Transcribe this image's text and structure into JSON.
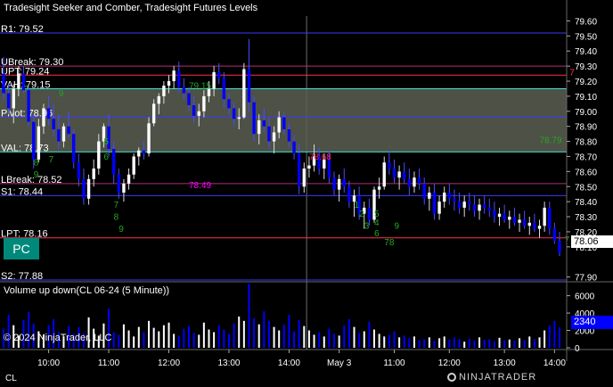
{
  "chart_data": {
    "type": "candlestick",
    "title": "Tradesight Seeker and Comber, Tradesight Futures Levels",
    "price_axis": {
      "min": 77.88,
      "max": 79.65,
      "ticks": [
        "79.60",
        "79.50",
        "79.40",
        "79.30",
        "79.20",
        "79.10",
        "79.00",
        "78.90",
        "78.80",
        "78.70",
        "78.60",
        "78.50",
        "78.40",
        "78.30",
        "78.20",
        "78.10",
        "77.90"
      ]
    },
    "time_axis": {
      "labels": [
        "10:00",
        "11:00",
        "12:00",
        "13:00",
        "14:00",
        "May 3",
        "11:00",
        "12:00",
        "13:00",
        "14:00"
      ]
    },
    "session_break_label": "May 3",
    "levels": [
      {
        "label": "R1: 79.52",
        "value": 79.52,
        "color": "#3a3aff"
      },
      {
        "label": "UBreak: 79.30",
        "value": 79.3,
        "color": "#b03070"
      },
      {
        "label": "UPT: 79.24",
        "value": 79.24,
        "color": "#ff3050"
      },
      {
        "label": "VAH: 79.15",
        "value": 79.15,
        "color": "#40e0d0"
      },
      {
        "label": "Pivot: 78.96",
        "value": 78.96,
        "color": "#3a3aff"
      },
      {
        "label": "VAL: 78.73",
        "value": 78.73,
        "color": "#40e0d0"
      },
      {
        "label": "LBreak: 78.52",
        "value": 78.52,
        "color": "#b03070"
      },
      {
        "label": "S1: 78.44",
        "value": 78.44,
        "color": "#3a3aff"
      },
      {
        "label": "LPT: 78.16",
        "value": 78.16,
        "color": "#ff3050"
      },
      {
        "label": "S2: 77.88",
        "value": 77.88,
        "color": "#3a3aff"
      }
    ],
    "value_area": {
      "top": 79.15,
      "bottom": 78.73,
      "color": "#5a5f52"
    },
    "annotations": [
      {
        "text": "78.49",
        "price": 78.49,
        "bar": 37,
        "color": "#ff00ff"
      },
      {
        "text": "78.68",
        "price": 78.68,
        "bar": 61,
        "color": "#ff2060"
      },
      {
        "text": "79.15",
        "price": 79.15,
        "bar": 37,
        "color": "#22aa22"
      },
      {
        "text": "78.79",
        "price": 78.79,
        "bar": 107,
        "color": "#22aa22"
      },
      {
        "text": "7",
        "price": 79.24,
        "bar": 113,
        "color": "#ff3050"
      },
      {
        "text": "7",
        "price": 79.13,
        "bar": 4,
        "color": "#22aa22"
      },
      {
        "text": "8",
        "price": 78.64,
        "bar": 6,
        "color": "#22aa22"
      },
      {
        "text": "9",
        "price": 78.56,
        "bar": 6,
        "color": "#22aa22"
      },
      {
        "text": "9",
        "price": 79.1,
        "bar": 11,
        "color": "#22aa22"
      },
      {
        "text": "7",
        "price": 78.66,
        "bar": 9,
        "color": "#22aa22"
      },
      {
        "text": "5",
        "price": 78.78,
        "bar": 20,
        "color": "#22aa22"
      },
      {
        "text": "6",
        "price": 78.68,
        "bar": 20,
        "color": "#22aa22"
      },
      {
        "text": "7",
        "price": 78.36,
        "bar": 22,
        "color": "#22aa22"
      },
      {
        "text": "8",
        "price": 78.28,
        "bar": 22,
        "color": "#22aa22"
      },
      {
        "text": "9",
        "price": 78.2,
        "bar": 23,
        "color": "#22aa22"
      },
      {
        "text": "1",
        "price": 78.36,
        "bar": 70,
        "color": "#22aa22"
      },
      {
        "text": "2",
        "price": 78.3,
        "bar": 71,
        "color": "#22aa22"
      },
      {
        "text": "3",
        "price": 78.22,
        "bar": 72,
        "color": "#22aa22"
      },
      {
        "text": "4",
        "price": 78.24,
        "bar": 74,
        "color": "#22aa22"
      },
      {
        "text": "5",
        "price": 78.3,
        "bar": 74,
        "color": "#22aa22"
      },
      {
        "text": "6",
        "price": 78.17,
        "bar": 74,
        "color": "#22aa22"
      },
      {
        "text": "7",
        "price": 78.11,
        "bar": 76,
        "color": "#22aa22"
      },
      {
        "text": "8",
        "price": 78.11,
        "bar": 77,
        "color": "#22aa22"
      },
      {
        "text": "9",
        "price": 78.22,
        "bar": 78,
        "color": "#22aa22"
      },
      {
        "text": "7",
        "price": 78.13,
        "bar": 112,
        "color": "#22aa22"
      }
    ],
    "bars": [
      [
        79.25,
        79.36,
        79.08,
        79.12
      ],
      [
        79.12,
        79.18,
        78.98,
        79.02
      ],
      [
        79.02,
        79.18,
        78.92,
        79.15
      ],
      [
        79.15,
        79.3,
        79.1,
        79.25
      ],
      [
        79.25,
        79.3,
        79.12,
        79.14
      ],
      [
        79.14,
        79.16,
        78.9,
        78.93
      ],
      [
        78.93,
        78.98,
        78.62,
        78.68
      ],
      [
        78.68,
        78.95,
        78.66,
        78.9
      ],
      [
        78.9,
        79.05,
        78.85,
        79.02
      ],
      [
        79.02,
        79.1,
        78.9,
        78.95
      ],
      [
        78.95,
        79.05,
        78.83,
        78.88
      ],
      [
        78.88,
        78.98,
        78.75,
        78.8
      ],
      [
        78.8,
        78.92,
        78.76,
        78.9
      ],
      [
        78.9,
        79.0,
        78.82,
        78.85
      ],
      [
        78.85,
        78.88,
        78.62,
        78.66
      ],
      [
        78.66,
        78.72,
        78.5,
        78.55
      ],
      [
        78.55,
        78.62,
        78.38,
        78.42
      ],
      [
        78.42,
        78.58,
        78.38,
        78.55
      ],
      [
        78.55,
        78.68,
        78.5,
        78.62
      ],
      [
        78.62,
        78.85,
        78.58,
        78.8
      ],
      [
        78.8,
        78.92,
        78.76,
        78.9
      ],
      [
        78.9,
        78.98,
        78.7,
        78.75
      ],
      [
        78.75,
        78.8,
        78.52,
        78.58
      ],
      [
        78.58,
        78.62,
        78.42,
        78.46
      ],
      [
        78.46,
        78.55,
        78.4,
        78.52
      ],
      [
        78.52,
        78.62,
        78.48,
        78.58
      ],
      [
        78.58,
        78.72,
        78.55,
        78.7
      ],
      [
        78.7,
        78.76,
        78.64,
        78.74
      ],
      [
        78.74,
        78.8,
        78.68,
        78.72
      ],
      [
        78.72,
        78.96,
        78.7,
        78.92
      ],
      [
        78.92,
        79.08,
        78.9,
        79.05
      ],
      [
        79.05,
        79.12,
        78.98,
        79.1
      ],
      [
        79.1,
        79.2,
        79.05,
        79.17
      ],
      [
        79.17,
        79.24,
        79.12,
        79.2
      ],
      [
        79.2,
        79.3,
        79.15,
        79.27
      ],
      [
        79.27,
        79.33,
        79.12,
        79.16
      ],
      [
        79.16,
        79.22,
        79.08,
        79.12
      ],
      [
        79.12,
        79.16,
        79.0,
        79.04
      ],
      [
        79.04,
        79.1,
        78.92,
        78.97
      ],
      [
        78.97,
        79.05,
        78.9,
        79.0
      ],
      [
        79.0,
        79.14,
        78.96,
        79.1
      ],
      [
        79.1,
        79.2,
        79.06,
        79.15
      ],
      [
        79.15,
        79.3,
        79.1,
        79.26
      ],
      [
        79.26,
        79.32,
        79.18,
        79.22
      ],
      [
        79.22,
        79.26,
        79.02,
        79.08
      ],
      [
        79.08,
        79.12,
        78.98,
        79.02
      ],
      [
        79.02,
        79.06,
        78.9,
        78.95
      ],
      [
        78.95,
        79.02,
        78.88,
        78.96
      ],
      [
        78.96,
        79.32,
        78.95,
        79.28
      ],
      [
        79.28,
        79.48,
        79.0,
        79.06
      ],
      [
        79.06,
        79.1,
        78.8,
        78.85
      ],
      [
        78.85,
        78.98,
        78.78,
        78.94
      ],
      [
        78.94,
        79.02,
        78.86,
        78.9
      ],
      [
        78.9,
        78.96,
        78.75,
        78.8
      ],
      [
        78.8,
        78.9,
        78.72,
        78.86
      ],
      [
        78.86,
        79.0,
        78.82,
        78.96
      ],
      [
        78.96,
        79.0,
        78.84,
        78.88
      ],
      [
        78.88,
        78.92,
        78.76,
        78.8
      ],
      [
        78.8,
        78.84,
        78.68,
        78.72
      ],
      [
        78.72,
        78.78,
        78.45,
        78.5
      ],
      [
        78.5,
        78.66,
        78.46,
        78.62
      ],
      [
        78.62,
        78.7,
        78.56,
        78.64
      ],
      [
        78.64,
        78.78,
        78.6,
        78.7
      ],
      [
        78.7,
        78.76,
        78.58,
        78.62
      ],
      [
        78.62,
        78.72,
        78.55,
        78.68
      ],
      [
        78.68,
        78.74,
        78.52,
        78.56
      ],
      [
        78.56,
        78.6,
        78.44,
        78.48
      ],
      [
        78.48,
        78.58,
        78.4,
        78.55
      ],
      [
        78.55,
        78.62,
        78.46,
        78.5
      ],
      [
        78.5,
        78.54,
        78.36,
        78.4
      ],
      [
        78.4,
        78.48,
        78.3,
        78.44
      ],
      [
        78.44,
        78.5,
        78.28,
        78.32
      ],
      [
        78.32,
        78.4,
        78.22,
        78.36
      ],
      [
        78.36,
        78.42,
        78.24,
        78.28
      ],
      [
        78.28,
        78.5,
        78.26,
        78.48
      ],
      [
        78.48,
        78.56,
        78.42,
        78.5
      ],
      [
        78.5,
        78.7,
        78.48,
        78.66
      ],
      [
        78.66,
        78.74,
        78.58,
        78.62
      ],
      [
        78.62,
        78.68,
        78.52,
        78.56
      ],
      [
        78.56,
        78.64,
        78.48,
        78.6
      ],
      [
        78.6,
        78.66,
        78.52,
        78.55
      ],
      [
        78.55,
        78.62,
        78.44,
        78.5
      ],
      [
        78.5,
        78.6,
        78.46,
        78.56
      ],
      [
        78.56,
        78.62,
        78.48,
        78.52
      ],
      [
        78.52,
        78.56,
        78.38,
        78.42
      ],
      [
        78.42,
        78.5,
        78.34,
        78.46
      ],
      [
        78.46,
        78.52,
        78.28,
        78.32
      ],
      [
        78.32,
        78.44,
        78.28,
        78.4
      ],
      [
        78.4,
        78.5,
        78.36,
        78.46
      ],
      [
        78.46,
        78.52,
        78.38,
        78.42
      ],
      [
        78.42,
        78.48,
        78.34,
        78.4
      ],
      [
        78.4,
        78.46,
        78.32,
        78.36
      ],
      [
        78.36,
        78.44,
        78.3,
        78.4
      ],
      [
        78.4,
        78.46,
        78.34,
        78.38
      ],
      [
        78.38,
        78.44,
        78.3,
        78.34
      ],
      [
        78.34,
        78.42,
        78.28,
        78.38
      ],
      [
        78.38,
        78.44,
        78.32,
        78.36
      ],
      [
        78.36,
        78.42,
        78.3,
        78.34
      ],
      [
        78.34,
        78.4,
        78.26,
        78.3
      ],
      [
        78.3,
        78.36,
        78.24,
        78.32
      ],
      [
        78.32,
        78.38,
        78.26,
        78.28
      ],
      [
        78.28,
        78.34,
        78.22,
        78.3
      ],
      [
        78.3,
        78.36,
        78.24,
        78.26
      ],
      [
        78.26,
        78.32,
        78.2,
        78.28
      ],
      [
        78.28,
        78.34,
        78.22,
        78.24
      ],
      [
        78.24,
        78.3,
        78.18,
        78.26
      ],
      [
        78.26,
        78.32,
        78.2,
        78.22
      ],
      [
        78.22,
        78.28,
        78.16,
        78.24
      ],
      [
        78.24,
        78.4,
        78.2,
        78.36
      ],
      [
        78.36,
        78.4,
        78.18,
        78.22
      ],
      [
        78.22,
        78.26,
        78.12,
        78.14
      ],
      [
        78.14,
        78.2,
        78.04,
        78.06
      ]
    ],
    "current_price": "78.06",
    "volume": {
      "title": "Volume up down(CL 06-24 (5 Minute))",
      "axis_ticks": [
        "6000",
        "4000",
        "2000",
        "0"
      ],
      "max": 7400,
      "current_value": "2340",
      "values": [
        2200,
        3800,
        2600,
        1400,
        3200,
        4100,
        2800,
        1900,
        1500,
        2600,
        3300,
        1800,
        1300,
        2500,
        1600,
        2400,
        1700,
        3500,
        2200,
        1400,
        2800,
        4500,
        1800,
        1500,
        2700,
        2000,
        1300,
        2400,
        1800,
        3100,
        2300,
        1900,
        2600,
        2900,
        1600,
        1400,
        2200,
        2500,
        1700,
        1500,
        2900,
        2100,
        1800,
        2600,
        2100,
        1600,
        2800,
        3600,
        3100,
        7400,
        3400,
        2700,
        4200,
        3100,
        2400,
        2000,
        2700,
        3800,
        1900,
        3200,
        2500,
        2000,
        1500,
        1800,
        1300,
        2200,
        1600,
        1400,
        2600,
        3300,
        2400,
        1700,
        1900,
        3000,
        2100,
        1600,
        1300,
        1500,
        1900,
        1200,
        1400,
        1100,
        1300,
        900,
        1000,
        1200,
        800,
        1100,
        1300,
        950,
        1200,
        1000,
        700,
        1050,
        850,
        1200,
        900,
        1000,
        750,
        1150,
        850,
        950,
        800,
        1100,
        900,
        1300,
        1000,
        1200,
        2000,
        2600,
        3100,
        2340
      ],
      "up_color": "#ffffff",
      "down_color": "#0000ff"
    }
  },
  "overlays": {
    "pc_button": "PC",
    "copyright": "© 2024 NinjaTrader, LLC",
    "corner_label": "CL",
    "logo": "NINJATRADER"
  },
  "colors": {
    "up_candle": "#ffffff",
    "down_candle": "#0000ff",
    "background": "#000000",
    "grid": "#2a2a2a"
  }
}
